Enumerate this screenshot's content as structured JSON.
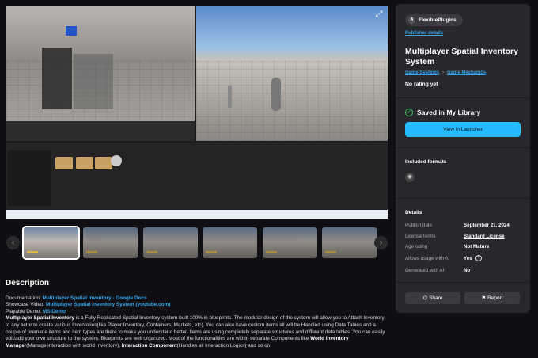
{
  "media": {
    "expand_icon": "expand-icon"
  },
  "gallery": {
    "thumbnail_count": 6,
    "selected_index": 0,
    "prev_icon": "chevron-left-icon",
    "next_icon": "chevron-right-icon"
  },
  "description": {
    "heading": "Description",
    "documentation_label": "Documentation: ",
    "documentation_link": "Multiplayer Spatial Inventory - Google Docs",
    "video_label": "Showcase Video: ",
    "video_link": "Multiplayer Spatial Inventory System (youtube.com)",
    "demo_label": "Playable Demo: ",
    "demo_link": "MSIDemo",
    "bold1": "Multiplayer Spatial Inventory",
    "body1": " is a Fully Replicated Spatial Inventory system built 100% in blueprints. The modular design of the system will allow you to Attach Inventory to any actor to create various Inventories(like Player Inventory, Containers, Markets, etc). You can also have custom items all will be Handled using Data Tables and a couple of premade items and item types are there to make you understand better. Items are using completely separate structures and different data tables. You can easily edit/add your own structure to the system. Blueprints are well organized. Most of the functionalities are within separate Components like ",
    "bold2": "World Inventory Manager",
    "body2": "(Manage interaction with world Inventory), ",
    "bold3": "Interaction Component",
    "body3": "(Handles all Interaction Logics) and so on."
  },
  "sidebar": {
    "publisher": "FlexiblePlugins",
    "publisher_details": "Publisher details",
    "title": "Multiplayer Spatial Inventory System",
    "category1": "Game Systems",
    "category2": "Game Mechanics",
    "rating": "No rating yet",
    "saved": "Saved in My Library",
    "view_button": "View in Launcher",
    "formats_heading": "Included formats",
    "details_heading": "Details",
    "details": [
      {
        "label": "Publish date",
        "value": "September 21, 2024"
      },
      {
        "label": "License terms",
        "value": "Standard License"
      },
      {
        "label": "Age rating",
        "value": "Not Mature"
      },
      {
        "label": "Allows usage with AI",
        "value": "Yes"
      },
      {
        "label": "Generated with AI",
        "value": "No"
      }
    ],
    "share": "Share",
    "report": "Report",
    "accent": "#26bbff"
  }
}
